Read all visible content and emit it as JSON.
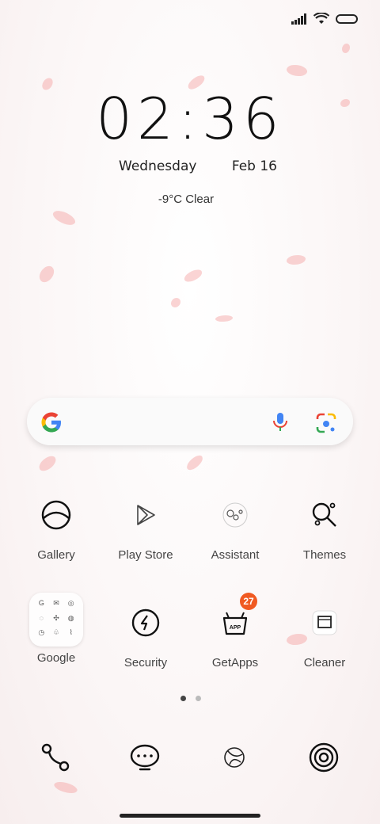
{
  "status": {
    "signal_icon": "signal-bars-icon",
    "wifi_icon": "wifi-icon",
    "battery_icon": "battery-icon"
  },
  "clock": {
    "time": "02:36",
    "weekday": "Wednesday",
    "date": "Feb 16"
  },
  "weather": {
    "text": "-9°C Clear"
  },
  "search": {
    "logo": "google-g-icon",
    "mic": "mic-icon",
    "lens": "lens-camera-icon"
  },
  "apps_row1": [
    {
      "label": "Gallery",
      "icon": "gallery-icon"
    },
    {
      "label": "Play Store",
      "icon": "play-store-icon"
    },
    {
      "label": "Assistant",
      "icon": "assistant-icon"
    },
    {
      "label": "Themes",
      "icon": "themes-icon"
    }
  ],
  "apps_row2": [
    {
      "label": "Google",
      "icon": "google-folder"
    },
    {
      "label": "Security",
      "icon": "security-icon"
    },
    {
      "label": "GetApps",
      "icon": "getapps-icon",
      "badge": "27",
      "badge_inner": "APP"
    },
    {
      "label": "Cleaner",
      "icon": "cleaner-icon"
    }
  ],
  "page_indicator": {
    "count": 2,
    "active": 0
  },
  "dock": [
    {
      "icon": "phone-icon"
    },
    {
      "icon": "messages-icon"
    },
    {
      "icon": "browser-icon"
    },
    {
      "icon": "camera-icon"
    }
  ],
  "colors": {
    "badge": "#f05a22",
    "petal": "#f4a0a0"
  }
}
